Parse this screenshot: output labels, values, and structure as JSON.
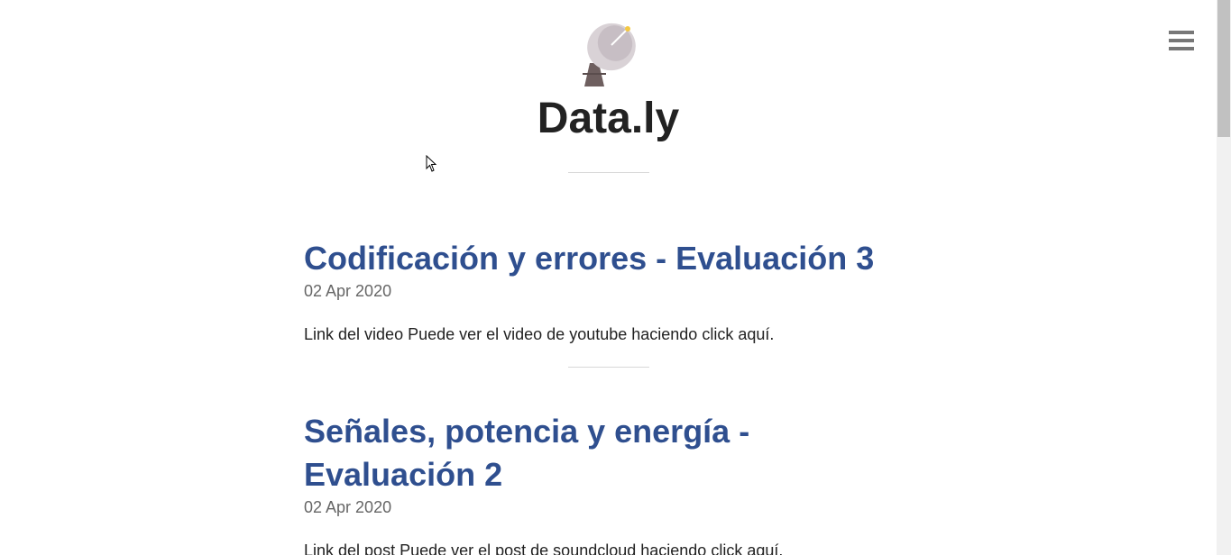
{
  "site": {
    "title": "Data.ly",
    "logo_icon": "satellite-dish-icon"
  },
  "header": {
    "menu_icon": "hamburger-menu-icon"
  },
  "posts": [
    {
      "title": "Codificación y errores - Evaluación 3",
      "date": "02 Apr 2020",
      "excerpt": "Link del video Puede ver el video de youtube haciendo click aquí."
    },
    {
      "title": "Señales, potencia y energía - Evaluación 2",
      "date": "02 Apr 2020",
      "excerpt": "Link del post Puede ver el post de soundcloud haciendo click aquí."
    }
  ],
  "colors": {
    "post_title": "#2f4f8f",
    "site_title": "#222222",
    "date": "#666666"
  }
}
